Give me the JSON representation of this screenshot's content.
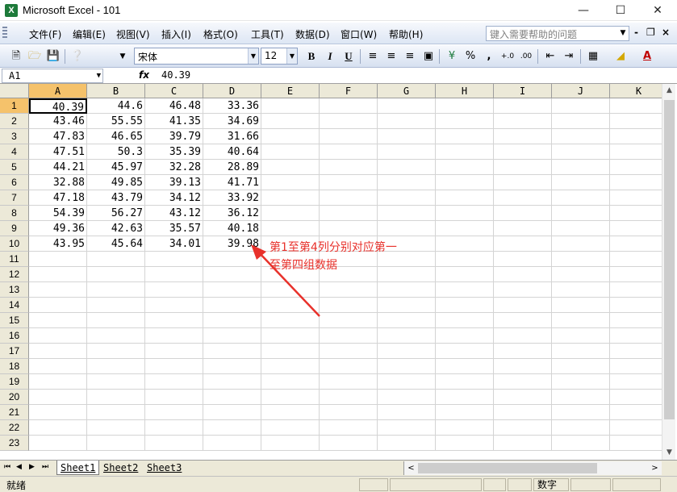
{
  "window": {
    "title": "Microsoft Excel - 101",
    "icon": "excel-icon",
    "controls": [
      "minimize",
      "maximize",
      "close"
    ]
  },
  "menu": {
    "items": [
      "文件(F)",
      "编辑(E)",
      "视图(V)",
      "插入(I)",
      "格式(O)",
      "工具(T)",
      "数据(D)",
      "窗口(W)",
      "帮助(H)"
    ],
    "help_placeholder": "键入需要帮助的问题"
  },
  "toolbar": {
    "font_name": "宋体",
    "font_size": "12",
    "bold": "B",
    "italic": "I",
    "underline": "U",
    "percent": "%",
    "comma": ","
  },
  "formula_bar": {
    "name_box": "A1",
    "fx_label": "fx",
    "formula": "40.39"
  },
  "grid": {
    "columns": [
      "A",
      "B",
      "C",
      "D",
      "E",
      "F",
      "G",
      "H",
      "I",
      "J",
      "K"
    ],
    "rows": [
      "1",
      "2",
      "3",
      "4",
      "5",
      "6",
      "7",
      "8",
      "9",
      "10",
      "11",
      "12",
      "13",
      "14",
      "15",
      "16",
      "17",
      "18",
      "19",
      "20",
      "21",
      "22",
      "23"
    ],
    "active_cell": "A1",
    "data": [
      [
        "40.39",
        "44.6",
        "46.48",
        "33.36"
      ],
      [
        "43.46",
        "55.55",
        "41.35",
        "34.69"
      ],
      [
        "47.83",
        "46.65",
        "39.79",
        "31.66"
      ],
      [
        "47.51",
        "50.3",
        "35.39",
        "40.64"
      ],
      [
        "44.21",
        "45.97",
        "32.28",
        "28.89"
      ],
      [
        "32.88",
        "49.85",
        "39.13",
        "41.71"
      ],
      [
        "47.18",
        "43.79",
        "34.12",
        "33.92"
      ],
      [
        "54.39",
        "56.27",
        "43.12",
        "36.12"
      ],
      [
        "49.36",
        "42.63",
        "35.57",
        "40.18"
      ],
      [
        "43.95",
        "45.64",
        "34.01",
        "39.98"
      ]
    ]
  },
  "annotation": {
    "line1": "第1至第4列分别对应第一",
    "line2": "至第四组数据",
    "color": "#e8312b"
  },
  "sheets": {
    "tabs": [
      "Sheet1",
      "Sheet2",
      "Sheet3"
    ],
    "active": "Sheet1"
  },
  "status": {
    "ready": "就绪",
    "mode": "数字"
  }
}
